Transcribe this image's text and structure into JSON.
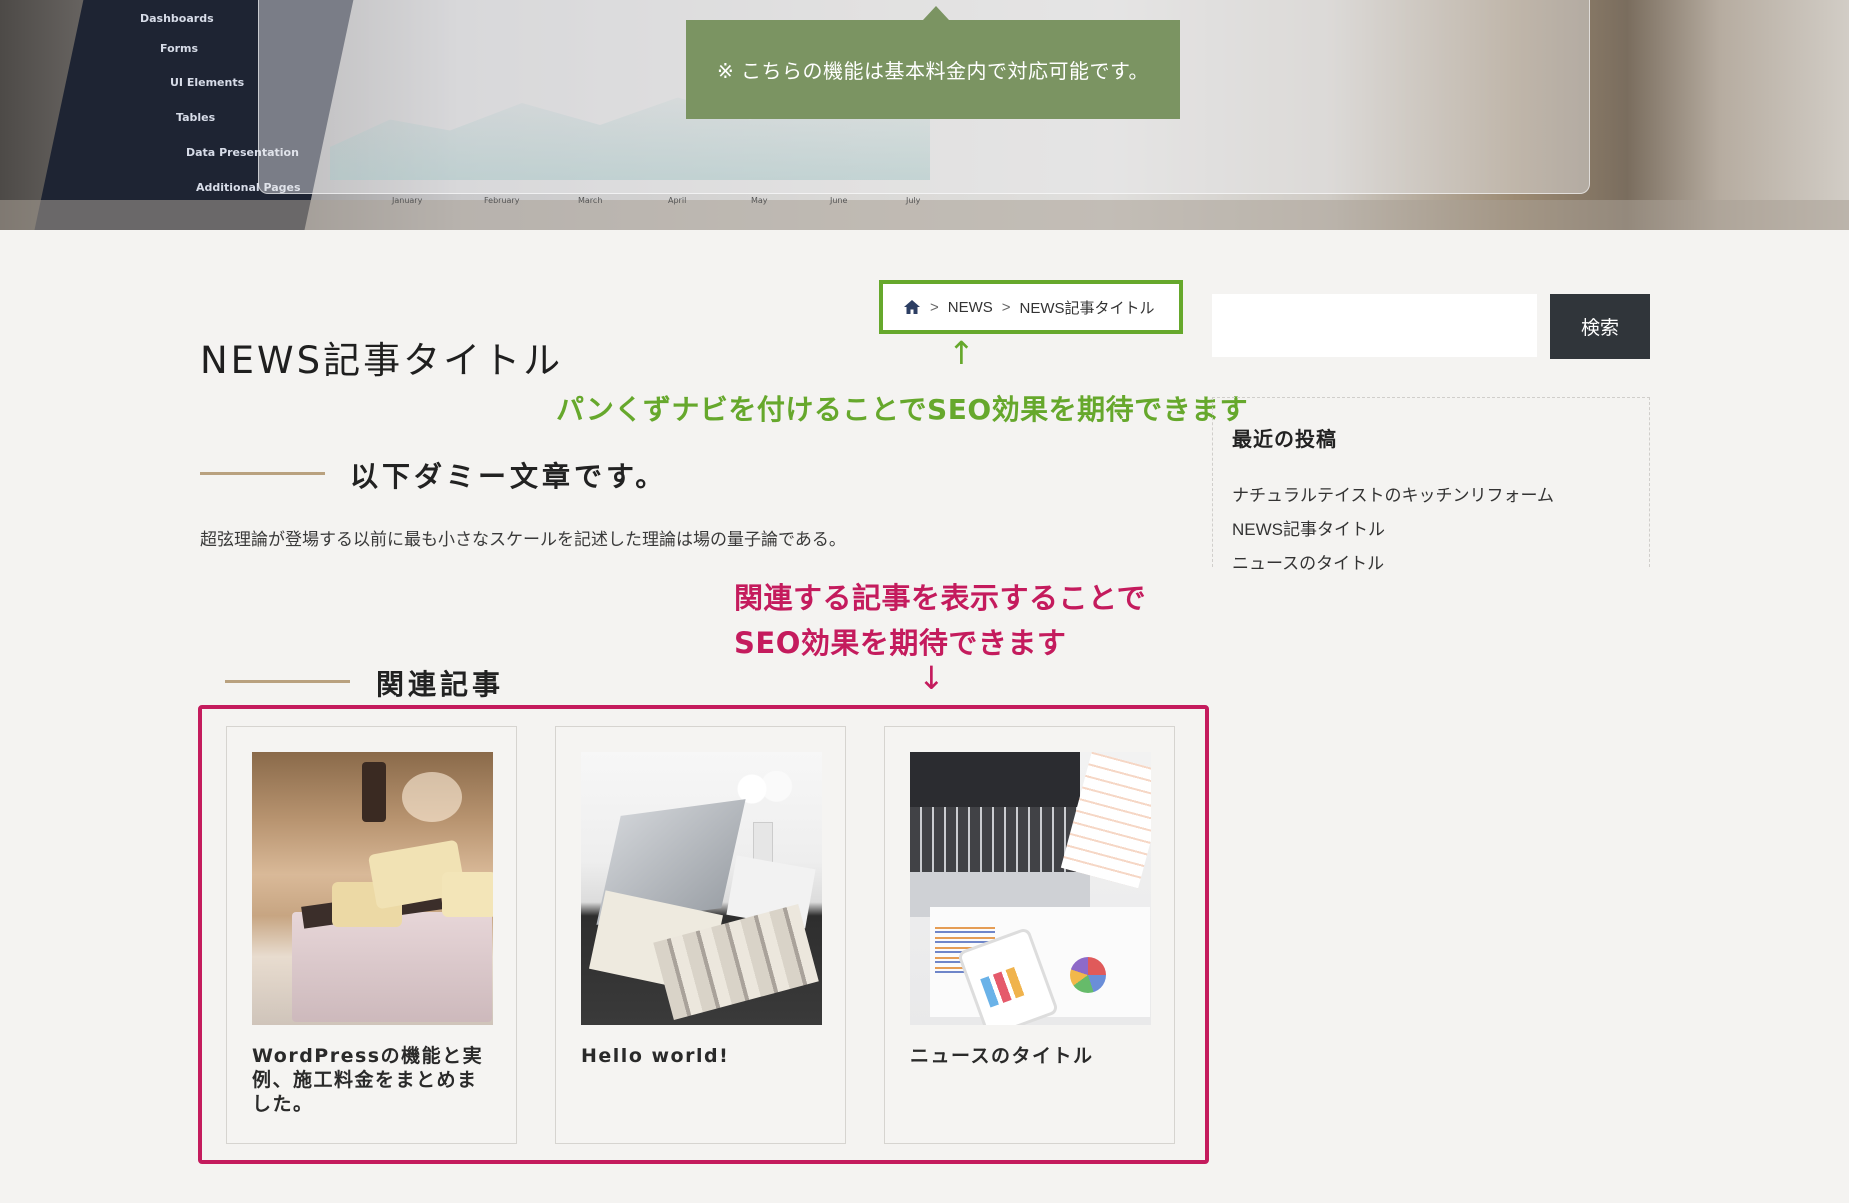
{
  "hero": {
    "notice": "※ こちらの機能は基本料金内で対応可能です。",
    "sidebar_menu": [
      "Dashboards",
      "Forms",
      "UI Elements",
      "Tables",
      "Data Presentation",
      "Additional Pages"
    ],
    "chart_months": [
      "January",
      "February",
      "March",
      "April",
      "May",
      "June",
      "July"
    ]
  },
  "page": {
    "title": "NEWS記事タイトル",
    "section_heading": "以下ダミー文章です。",
    "body_text": "超弦理論が登場する以前に最も小さなスケールを記述した理論は場の量子論である。"
  },
  "breadcrumb": {
    "separator": ">",
    "items": [
      "NEWS",
      "NEWS記事タイトル"
    ]
  },
  "annotations": {
    "breadcrumb_arrow": "↑",
    "breadcrumb_note": "パンくずナビを付けることでSEO効果を期待できます",
    "related_note_line1": "関連する記事を表示することで",
    "related_note_line2": "SEO効果を期待できます",
    "related_arrow": "↓"
  },
  "related": {
    "heading": "関連記事",
    "cards": [
      {
        "title": "WordPressの機能と実例、施工料金をまとめました。"
      },
      {
        "title": "Hello world!"
      },
      {
        "title": "ニュースのタイトル"
      }
    ]
  },
  "sidebar": {
    "search_placeholder": "",
    "search_button": "検索",
    "recent_title": "最近の投稿",
    "recent_posts": [
      "ナチュラルテイストのキッチンリフォーム",
      "NEWS記事タイトル",
      "ニュースのタイトル"
    ]
  },
  "colors": {
    "background": "#f4f3f1",
    "notice_green": "#7b9462",
    "annotation_green": "#66a82c",
    "annotation_pink": "#c41b5d",
    "rule_tan": "#b9a17f",
    "search_button": "#30353a"
  },
  "icons": {
    "breadcrumb_home": "home-icon"
  }
}
